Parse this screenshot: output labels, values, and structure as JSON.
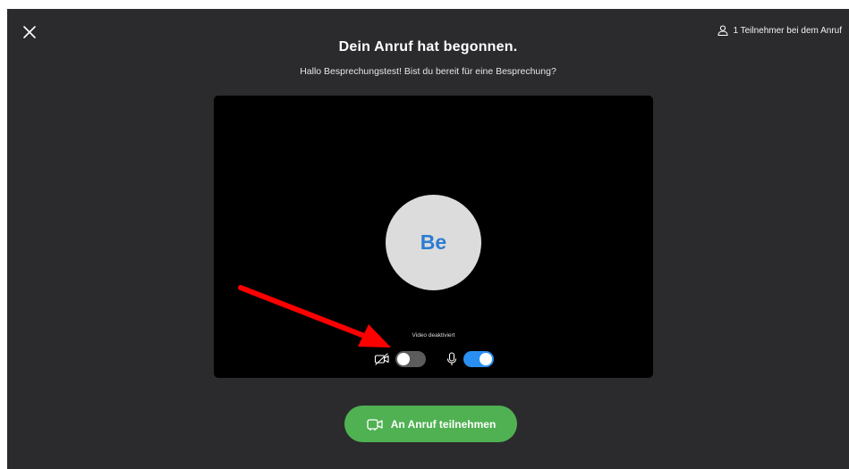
{
  "header": {
    "participants_label": "1 Teilnehmer bei dem Anruf"
  },
  "main": {
    "title": "Dein Anruf hat begonnen.",
    "subtitle": "Hallo Besprechungstest! Bist du bereit für eine Besprechung?"
  },
  "preview": {
    "avatar_initials": "Be",
    "video_status": "Video deaktiviert",
    "camera_toggle_on": false,
    "mic_toggle_on": true
  },
  "join_button": {
    "label": "An Anruf teilnehmen"
  },
  "icons": {
    "close": "close-icon",
    "participants": "person-icon",
    "camera": "camera-off-icon",
    "mic": "microphone-icon",
    "join": "video-call-icon"
  },
  "colors": {
    "background": "#2b2b2e",
    "preview": "#000000",
    "avatar_bg": "#dcdcdc",
    "avatar_text": "#2b7cd3",
    "toggle_on": "#2a8ff2",
    "toggle_off": "#5c5c5c",
    "join_button": "#50b153",
    "annotation_arrow": "#ff0000"
  }
}
